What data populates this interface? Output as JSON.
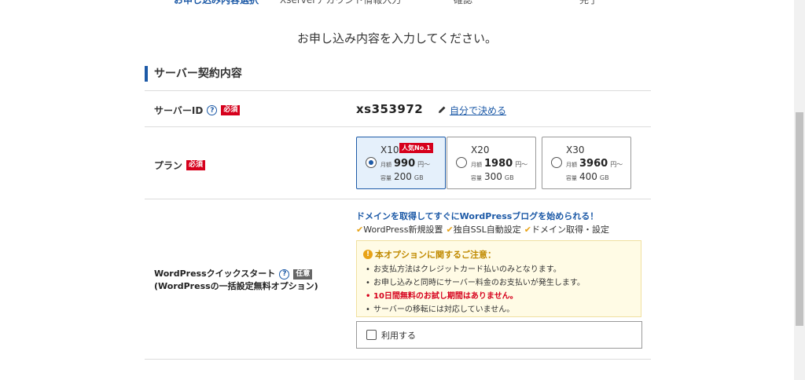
{
  "steps": [
    "お申し込み内容選択",
    "Xserverアカウント情報入力",
    "確認",
    "完了"
  ],
  "intro": "お申し込み内容を入力してください。",
  "section_title": "サーバー契約内容",
  "server_id": {
    "label": "サーバーID",
    "required": "必須",
    "value": "xs353972",
    "link": "自分で決める"
  },
  "plan": {
    "label": "プラン",
    "required": "必須",
    "options": [
      {
        "name": "X10",
        "badge": "人気No.1",
        "monthly_label": "月額",
        "price": "990",
        "price_unit": "円～",
        "capacity_label": "容量",
        "capacity": "200",
        "capacity_unit": "GB",
        "selected": true
      },
      {
        "name": "X20",
        "badge": "",
        "monthly_label": "月額",
        "price": "1980",
        "price_unit": "円～",
        "capacity_label": "容量",
        "capacity": "300",
        "capacity_unit": "GB",
        "selected": false
      },
      {
        "name": "X30",
        "badge": "",
        "monthly_label": "月額",
        "price": "3960",
        "price_unit": "円～",
        "capacity_label": "容量",
        "capacity": "400",
        "capacity_unit": "GB",
        "selected": false
      }
    ]
  },
  "wordpress": {
    "label_line1": "WordPressクイックスタート",
    "optional": "任意",
    "label_line2": "(WordPressの一括設定無料オプション)",
    "headline": "ドメインを取得してすぐにWordPressブログを始められる！",
    "features": [
      "WordPress新規設置",
      "独自SSL自動設定",
      "ドメイン取得・設定"
    ],
    "notice_title": "本オプションに関するご注意：",
    "notice_items": [
      {
        "text": "お支払方法はクレジットカード払いのみとなります。",
        "emphasis": false
      },
      {
        "text": "お申し込みと同時にサーバー料金のお支払いが発生します。",
        "emphasis": false
      },
      {
        "text": "10日間無料のお試し期間はありません。",
        "emphasis": true
      },
      {
        "text": "サーバーの移転には対応していません。",
        "emphasis": false
      }
    ],
    "checkbox_label": "利用する"
  },
  "colors": {
    "accent": "#1d5aa7",
    "required": "#d6001c",
    "warning": "#e8a317"
  }
}
